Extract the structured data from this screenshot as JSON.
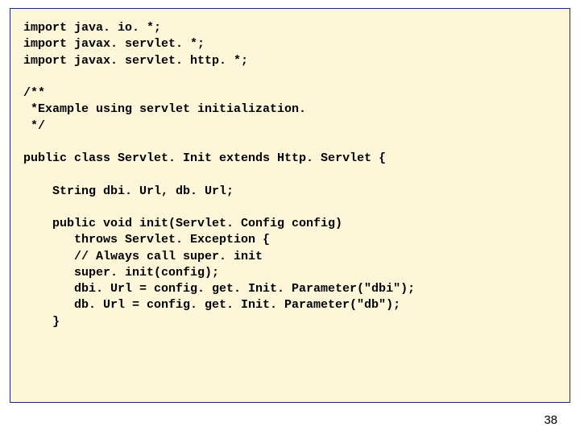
{
  "code": {
    "l1": "import java. io. *;",
    "l2": "import javax. servlet. *;",
    "l3": "import javax. servlet. http. *;",
    "l4": "",
    "l5": "/**",
    "l6": " *Example using servlet initialization.",
    "l7": " */",
    "l8": "",
    "l9": "public class Servlet. Init extends Http. Servlet {",
    "l10": "",
    "l11": "String dbi. Url, db. Url;",
    "l12": "",
    "l13": "public void init(Servlet. Config config)",
    "l14": "throws Servlet. Exception {",
    "l15": "// Always call super. init",
    "l16": "super. init(config);",
    "l17": "dbi. Url = config. get. Init. Parameter(\"dbi\");",
    "l18": "db. Url = config. get. Init. Parameter(\"db\");",
    "l19": "}"
  },
  "page_number": "38"
}
